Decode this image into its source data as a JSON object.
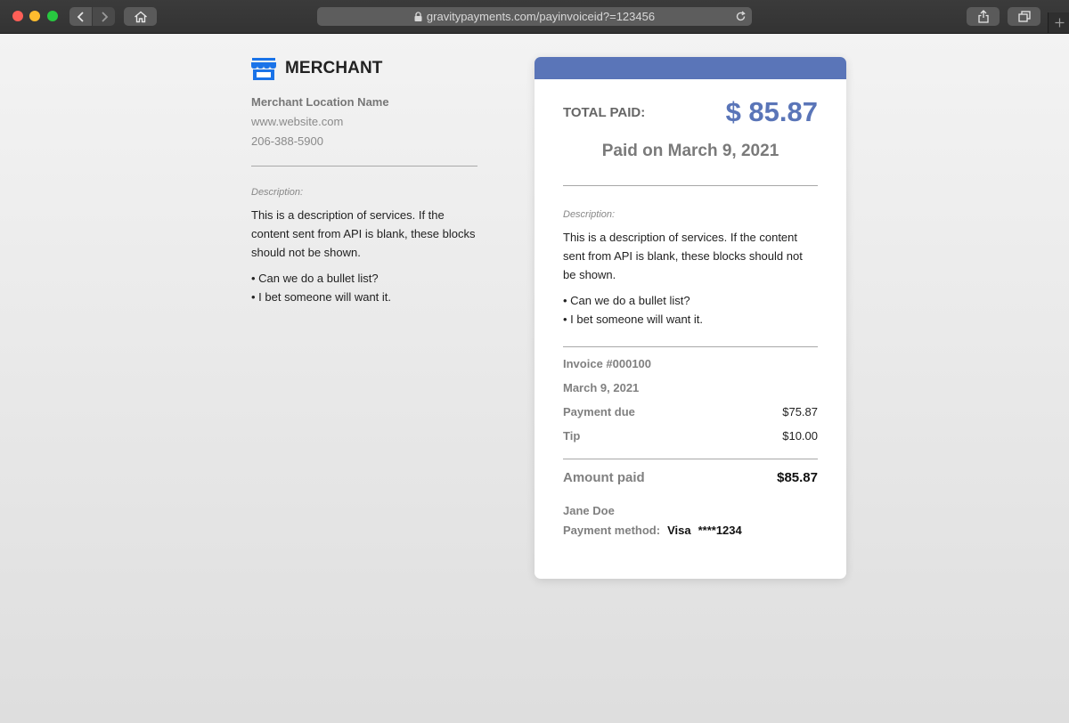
{
  "browser": {
    "url": "gravitypayments.com/payinvoiceid?=123456",
    "icons": [
      "back-icon",
      "forward-icon",
      "home-icon",
      "lock-icon",
      "reload-icon",
      "share-icon",
      "tabs-icon",
      "plus-icon"
    ]
  },
  "merchant": {
    "name": "MERCHANT",
    "location_name": "Merchant Location Name",
    "website": "www.website.com",
    "phone": "206-388-5900",
    "description_label": "Description:",
    "description": "This is a description of services. If the content sent from API is blank, these blocks should not be shown.",
    "bullets": [
      "• Can we do a bullet list?",
      "• I bet someone will want it."
    ],
    "icon": "storefront-icon",
    "accent_color": "#1a73e8"
  },
  "receipt": {
    "total_label": "TOTAL PAID:",
    "total_amount": "$ 85.87",
    "paid_on": "Paid on March 9, 2021",
    "description_label": "Description:",
    "description": "This is a description of services. If the content sent from API is blank, these blocks should not be shown.",
    "bullets": [
      "• Can we do a bullet list?",
      "• I bet someone will want it."
    ],
    "invoice_number": "Invoice #000100",
    "invoice_date": "March 9, 2021",
    "payment_due_label": "Payment due",
    "payment_due_value": "$75.87",
    "tip_label": "Tip",
    "tip_value": "$10.00",
    "amount_paid_label": "Amount paid",
    "amount_paid_value": "$85.87",
    "payer_name": "Jane Doe",
    "payment_method_label": "Payment method:",
    "card_brand": "Visa",
    "card_last4": "****1234",
    "accent_color": "#5a75b8"
  }
}
